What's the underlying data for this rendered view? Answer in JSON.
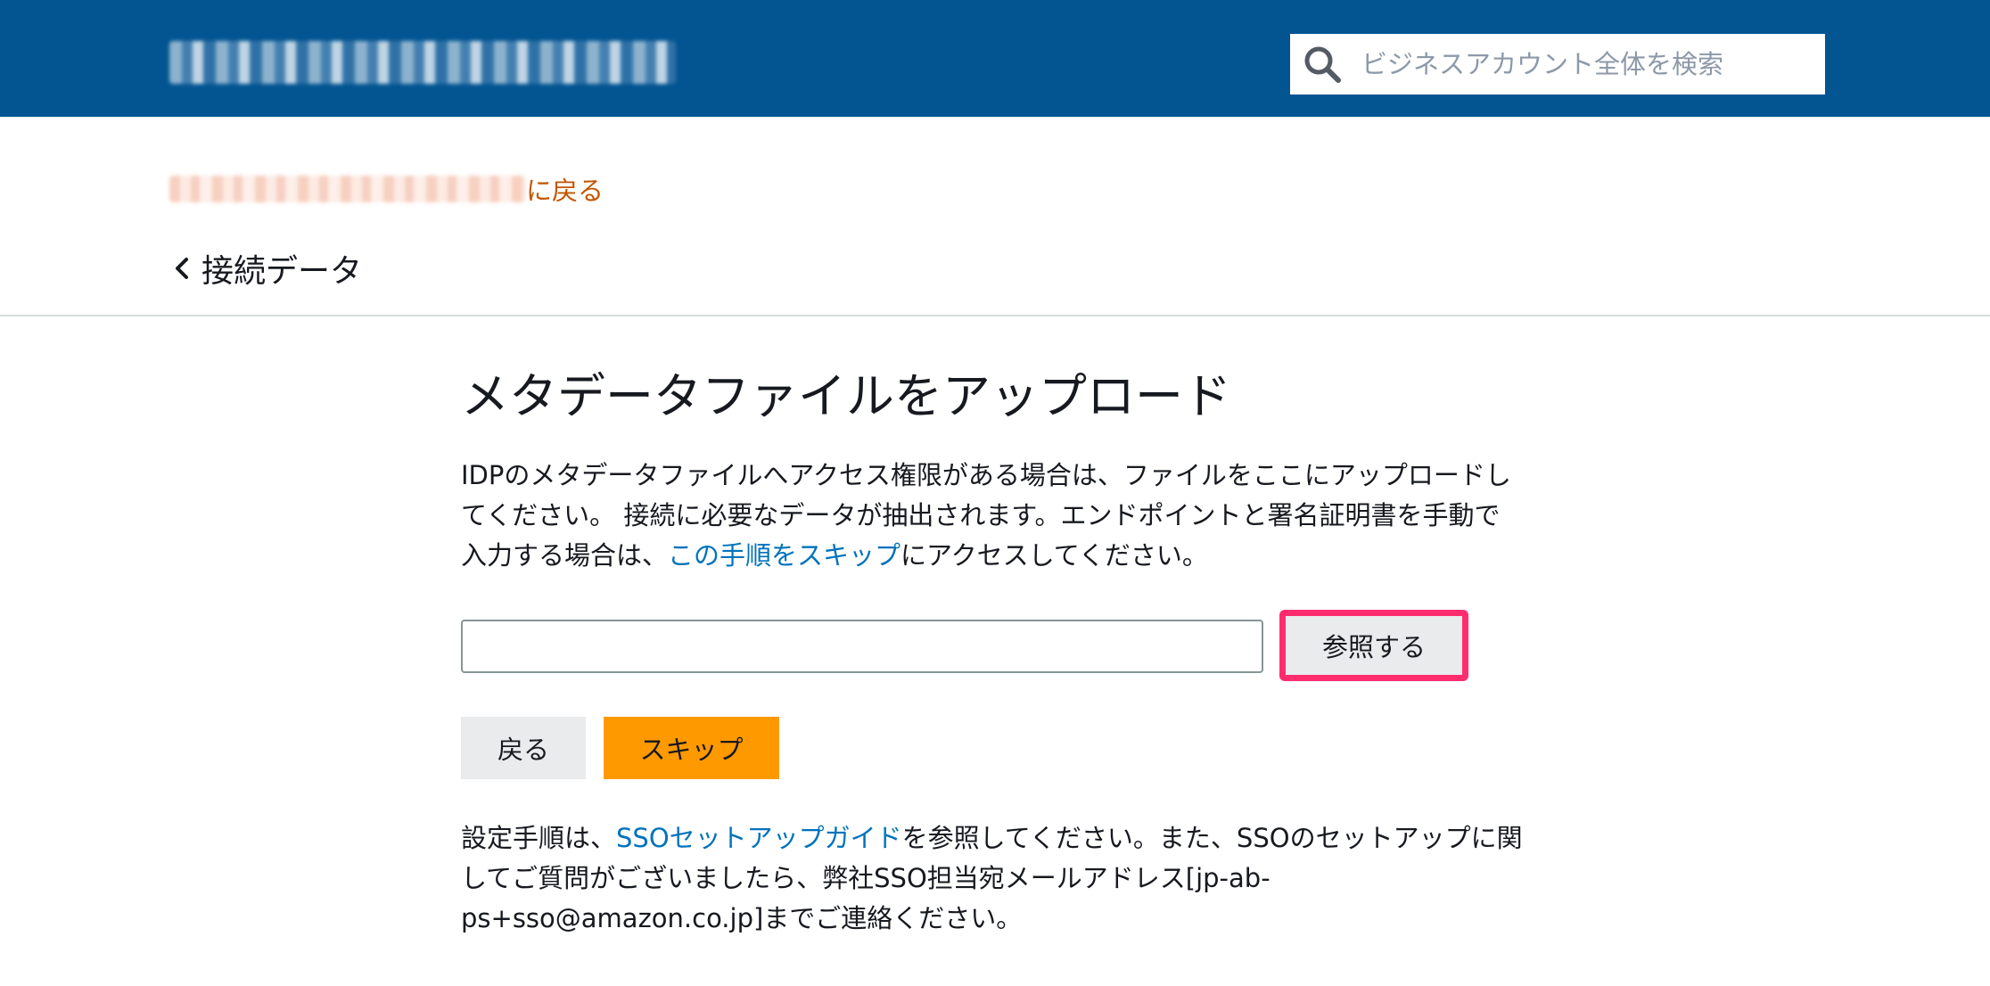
{
  "header": {
    "background": "#035592",
    "search": {
      "placeholder": "ビジネスアカウント全体を検索",
      "value": ""
    }
  },
  "back_link": {
    "suffix": "に戻る",
    "color": "#c45500"
  },
  "breadcrumb": {
    "label": "接続データ"
  },
  "main": {
    "title": "メタデータファイルをアップロード",
    "intro": {
      "part1": "IDPのメタデータファイルへアクセス権限がある場合は、ファイルをここにアップロードしてください。 接続に必要なデータが抽出されます。エンドポイントと署名証明書を手動で入力する場合は、",
      "link": "この手順をスキップ",
      "part2": "にアクセスしてください。"
    },
    "file_input": {
      "value": ""
    },
    "browse_label": "参照する",
    "back_label": "戻る",
    "skip_label": "スキップ",
    "help": {
      "part1": "設定手順は、",
      "link": "SSOセットアップガイド",
      "part2": "を参照してください。また、SSOのセットアップに関してご質問がございましたら、弊社SSO担当宛メールアドレス[jp-ab-ps+sso@amazon.co.jp]までご連絡ください。"
    }
  },
  "colors": {
    "accent_orange": "#ff9900",
    "link_blue": "#0073bb",
    "highlight": "#ff2d6f"
  }
}
